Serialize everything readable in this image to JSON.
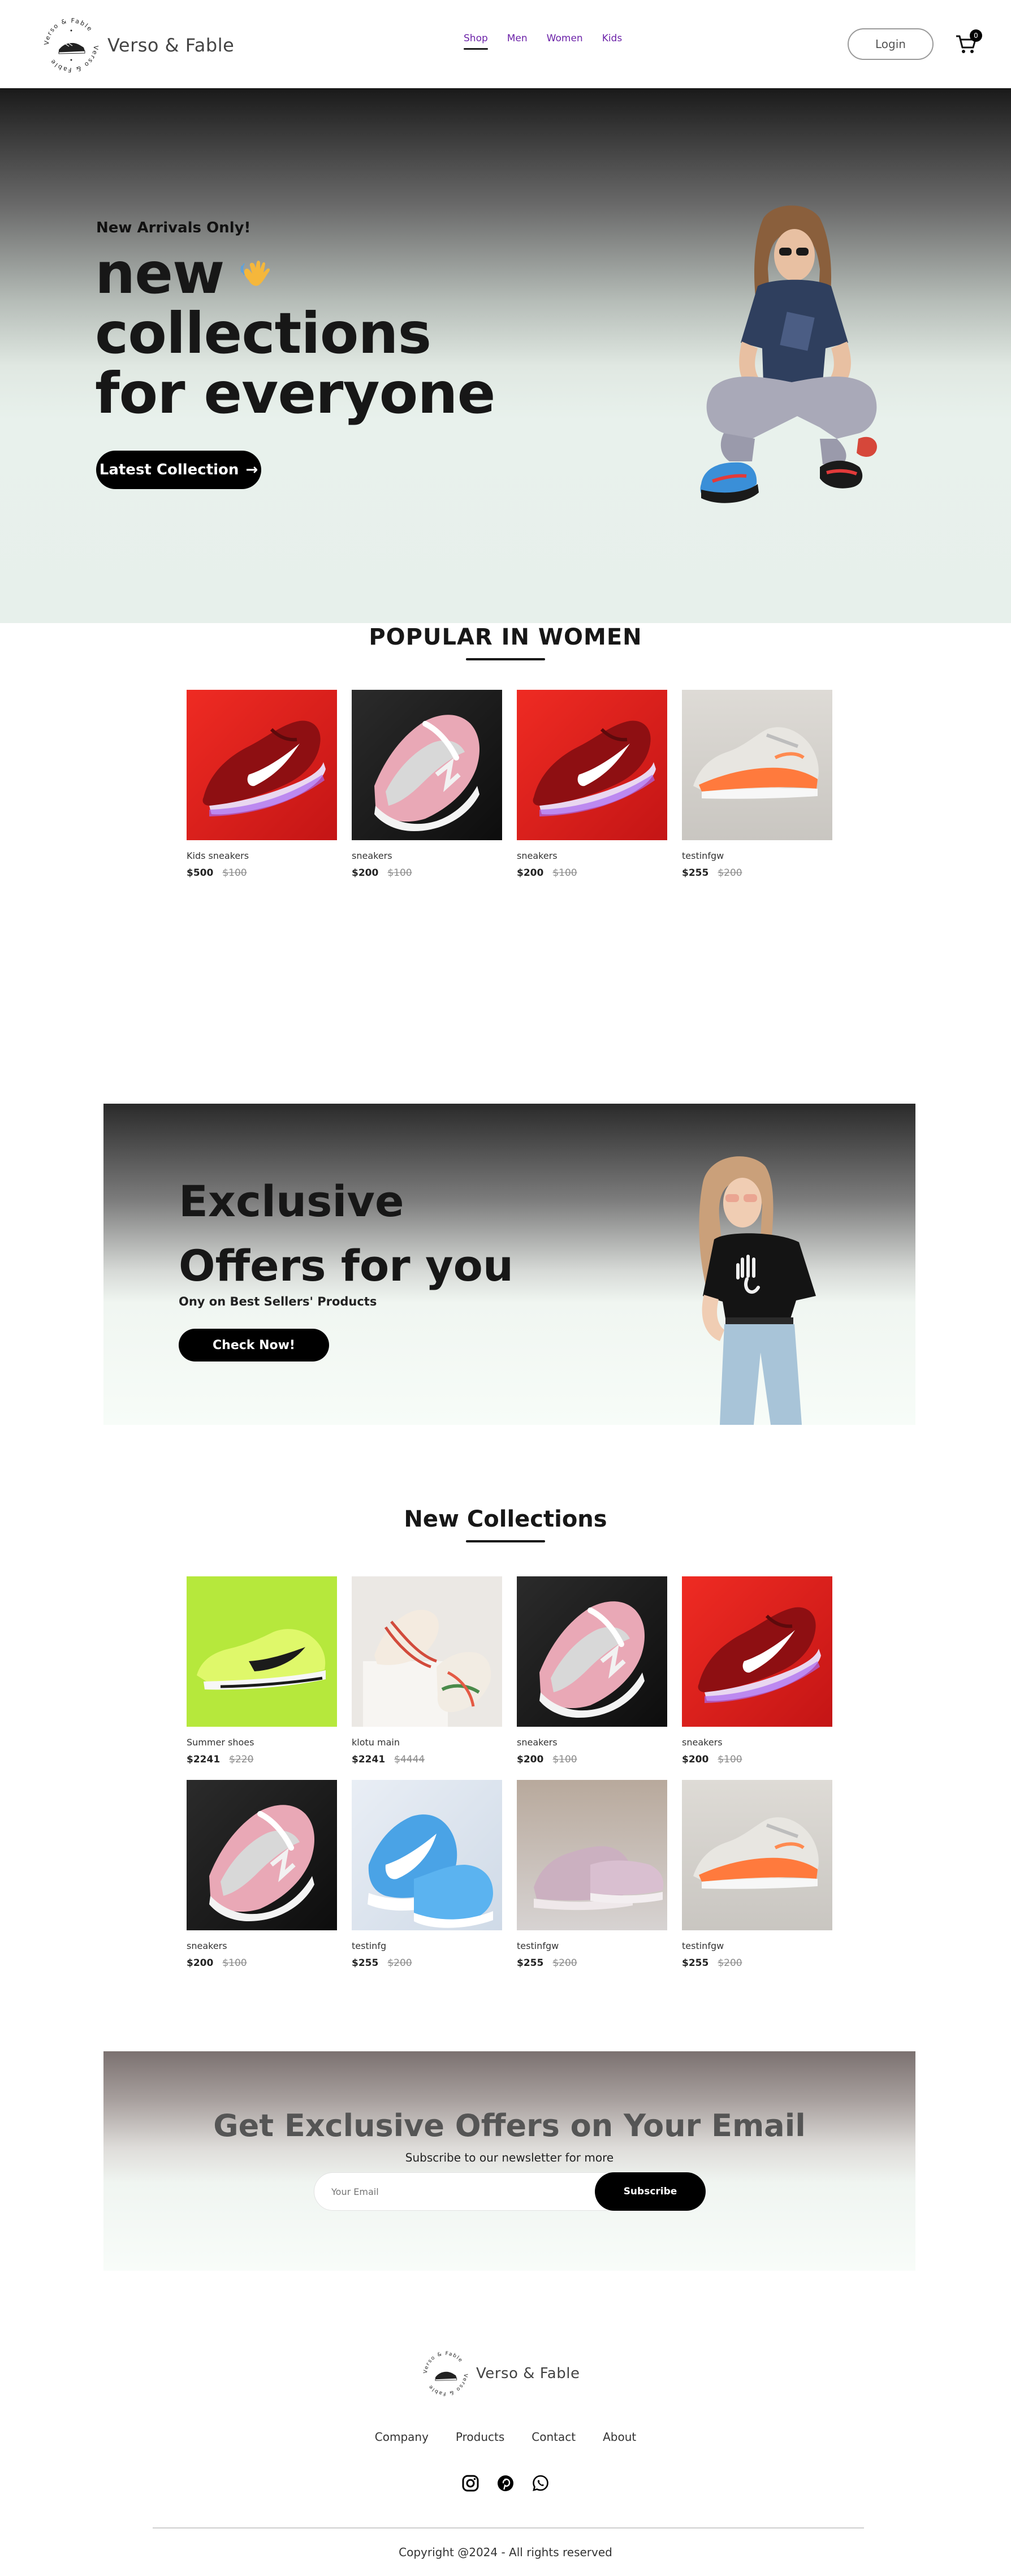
{
  "brand": {
    "name_part1": "Verso",
    "name_amp": "&",
    "name_part2": "Fable",
    "seal_text": "Verso & Fable"
  },
  "nav": {
    "items": [
      {
        "label": "Shop",
        "active": true
      },
      {
        "label": "Men",
        "active": false
      },
      {
        "label": "Women",
        "active": false
      },
      {
        "label": "Kids",
        "active": false
      }
    ],
    "login_label": "Login",
    "cart_count": "0"
  },
  "hero": {
    "eyebrow": "New Arrivals Only!",
    "title_line1": "new",
    "title_line2": "collections",
    "title_line3": "for everyone",
    "cta_label": "Latest Collection",
    "cta_arrow": "→"
  },
  "popular": {
    "heading": "POPULAR IN WOMEN",
    "products": [
      {
        "name": "Kids sneakers",
        "price": "$500",
        "old_price": "$100",
        "image": "red-sneaker"
      },
      {
        "name": "sneakers",
        "price": "$200",
        "old_price": "$100",
        "image": "pink-sneaker-dark"
      },
      {
        "name": "sneakers",
        "price": "$200",
        "old_price": "$100",
        "image": "red-sneaker"
      },
      {
        "name": "testinfgw",
        "price": "$255",
        "old_price": "$200",
        "image": "orange-sneaker"
      }
    ]
  },
  "offers": {
    "title_line1": "Exclusive",
    "title_line2": "Offers for you",
    "subtitle": "Ony on Best Sellers' Products",
    "cta_label": "Check Now!"
  },
  "new_collections": {
    "heading": "New Collections",
    "products": [
      {
        "name": "Summer shoes",
        "price": "$2241",
        "old_price": "$220",
        "image": "lime-sneaker"
      },
      {
        "name": "klotu main",
        "price": "$2241",
        "old_price": "$4444",
        "image": "lace-sneakers"
      },
      {
        "name": "sneakers",
        "price": "$200",
        "old_price": "$100",
        "image": "pink-sneaker-dark"
      },
      {
        "name": "sneakers",
        "price": "$200",
        "old_price": "$100",
        "image": "red-sneaker"
      },
      {
        "name": "sneakers",
        "price": "$200",
        "old_price": "$100",
        "image": "pink-sneaker-dark"
      },
      {
        "name": "testinfg",
        "price": "$255",
        "old_price": "$200",
        "image": "blue-sneaker"
      },
      {
        "name": "testinfgw",
        "price": "$255",
        "old_price": "$200",
        "image": "mauve-sneakers"
      },
      {
        "name": "testinfgw",
        "price": "$255",
        "old_price": "$200",
        "image": "orange-sneaker"
      }
    ]
  },
  "newsletter": {
    "title": "Get Exclusive Offers on Your Email",
    "subtitle": "Subscribe to our newsletter for more",
    "placeholder": "Your Email",
    "button_label": "Subscribe"
  },
  "footer": {
    "links": [
      "Company",
      "Products",
      "Contact",
      "About"
    ],
    "socials": [
      "instagram-icon",
      "pinterest-icon",
      "whatsapp-icon"
    ],
    "copyright": "Copyright @2024 - All rights reserved"
  },
  "colors": {
    "nav_link": "#6b21a8",
    "button_bg": "#000000",
    "heading_text": "#171717",
    "old_price": "#8a8a8a"
  }
}
